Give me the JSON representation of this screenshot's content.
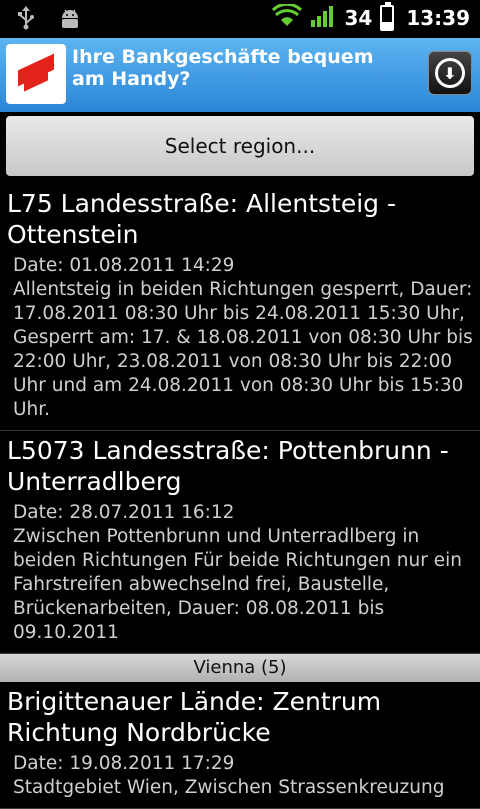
{
  "status_bar": {
    "icons_left": [
      "usb-icon",
      "android-debug-icon"
    ],
    "signal_strength": 4,
    "battery_level": "34",
    "time": "13:39",
    "wifi_icon": "wifi-icon",
    "accent": "#66cc33"
  },
  "ad": {
    "text": "Ihre Bankgeschäfte bequem am Handy?",
    "logo_icon": "bank-logo-icon",
    "download_icon": "download-icon",
    "background": "#3c9be6"
  },
  "region_button": {
    "label": "Select region..."
  },
  "list": {
    "items": [
      {
        "title": "L75 Landesstraße: Allentsteig - Ottenstein",
        "date": "Date: 01.08.2011 14:29",
        "description": "Allentsteig in beiden Richtungen gesperrt, Dauer: 17.08.2011 08:30 Uhr bis 24.08.2011 15:30 Uhr, Gesperrt am: 17. & 18.08.2011 von 08:30 Uhr bis 22:00 Uhr, 23.08.2011 von 08:30 Uhr bis 22:00 Uhr und am 24.08.2011 von 08:30 Uhr bis 15:30 Uhr."
      },
      {
        "title": "L5073 Landesstraße: Pottenbrunn - Unterradlberg",
        "date": "Date: 28.07.2011 16:12",
        "description": "Zwischen Pottenbrunn und Unterradlberg in beiden Richtungen Für beide Richtungen nur ein Fahrstreifen abwechselnd frei, Baustelle, Brückenarbeiten, Dauer: 08.08.2011 bis 09.10.2011"
      }
    ],
    "section_header": "Vienna (5)",
    "section_items": [
      {
        "title": "Brigittenauer Lände: Zentrum Richtung Nordbrücke",
        "date": "Date: 19.08.2011 17:29",
        "description": "Stadtgebiet Wien, Zwischen Strassenkreuzung"
      }
    ]
  }
}
